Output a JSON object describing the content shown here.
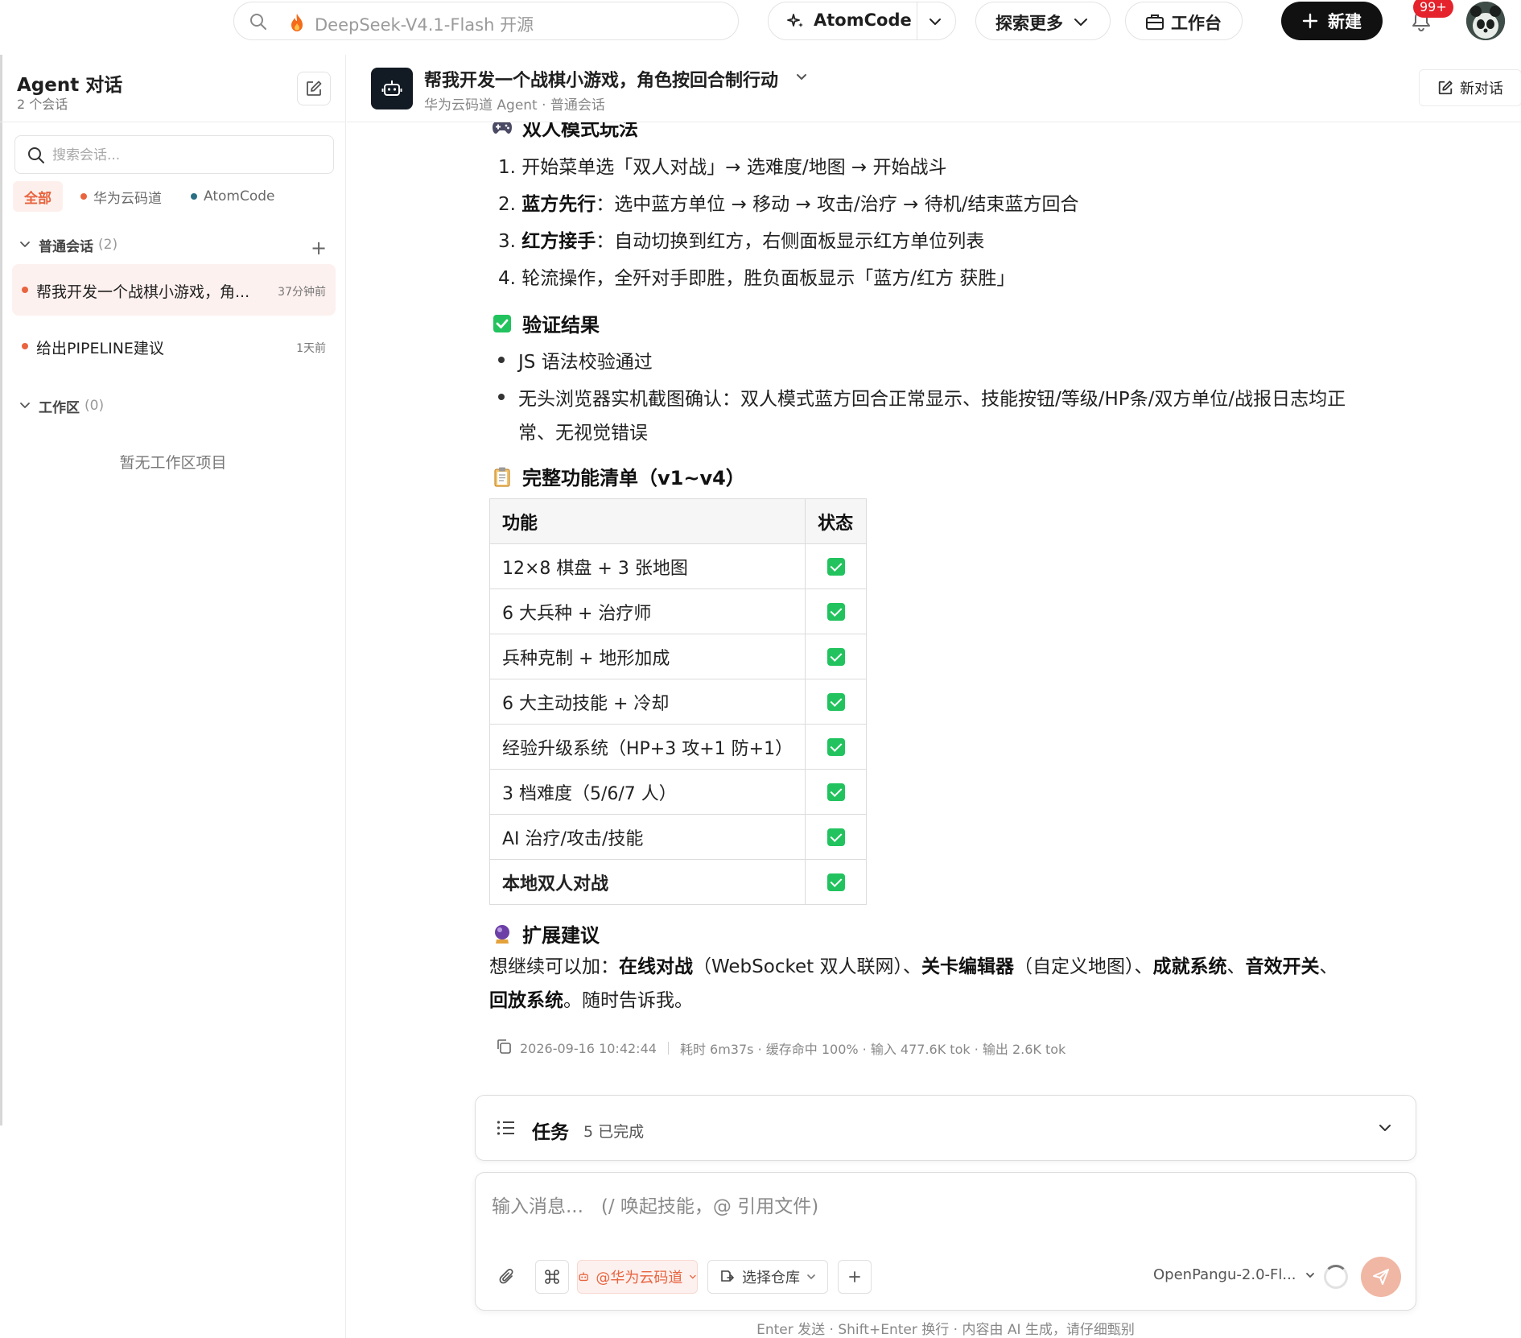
{
  "topbar": {
    "search_placeholder": "DeepSeek-V4.1-Flash 开源",
    "atomcode_label": "AtomCode",
    "explore_label": "探索更多",
    "workbench_label": "工作台",
    "new_label": "新建",
    "notification_badge": "99+"
  },
  "sidebar": {
    "title": "Agent 对话",
    "subtitle": "2 个会话",
    "search_placeholder": "搜索会话...",
    "filters": [
      {
        "label": "全部",
        "color": "#e8643f"
      },
      {
        "label": "华为云码道",
        "color": "#e8643f"
      },
      {
        "label": "AtomCode",
        "color": "#2a6f84"
      }
    ],
    "groups": {
      "normal": {
        "label": "普通会话",
        "count": "(2)"
      },
      "workspace": {
        "label": "工作区",
        "count": "(0)"
      }
    },
    "conversations": [
      {
        "title": "帮我开发一个战棋小游戏，角...",
        "time": "37分钟前"
      },
      {
        "title": "给出PIPELINE建议",
        "time": "1天前"
      }
    ],
    "workspace_empty": "暂无工作区项目"
  },
  "main": {
    "title": "帮我开发一个战棋小游戏，角色按回合制行动",
    "subtitle": "华为云码道 Agent · 普通会话",
    "new_chat_label": "新对话",
    "sections": {
      "mode_title": "双人模式玩法",
      "verify_title": "验证结果",
      "features_title": "完整功能清单（v1~v4）",
      "ext_title": "扩展建议"
    },
    "mode_steps": [
      {
        "num": "1.",
        "bold": "",
        "text": "开始菜单选「双人对战」→ 选难度/地图 → 开始战斗"
      },
      {
        "num": "2.",
        "bold": "蓝方先行",
        "text": "：选中蓝方单位 → 移动 → 攻击/治疗 → 待机/结束蓝方回合"
      },
      {
        "num": "3.",
        "bold": "红方接手",
        "text": "：自动切换到红方，右侧面板显示红方单位列表"
      },
      {
        "num": "4.",
        "bold": "",
        "text": "轮流操作，全歼对手即胜，胜负面板显示「蓝方/红方 获胜」"
      }
    ],
    "verify": {
      "line1": "JS 语法校验通过",
      "line2a": "无头浏览器实机截图确认：双人模式蓝方回合正常显示、技能按钮/等级/HP条/双方单位/战报日志均正",
      "line2b": "常、无视觉错误"
    },
    "table": {
      "headers": [
        "功能",
        "状态"
      ],
      "rows": [
        {
          "feature": "12×8 棋盘 + 3 张地图",
          "done": true
        },
        {
          "feature": "6 大兵种 + 治疗师",
          "done": true
        },
        {
          "feature": "兵种克制 + 地形加成",
          "done": true
        },
        {
          "feature": "6 大主动技能 + 冷却",
          "done": true
        },
        {
          "feature": "经验升级系统（HP+3 攻+1 防+1）",
          "done": true
        },
        {
          "feature": "3 档难度（5/6/7 人）",
          "done": true
        },
        {
          "feature": "AI 治疗/攻击/技能",
          "done": true
        },
        {
          "feature": "本地双人对战",
          "done": true
        }
      ]
    },
    "ext": {
      "p1": "想继续可以加：",
      "b1": "在线对战",
      "p2": "（WebSocket 双人联网）、",
      "b2": "关卡编辑器",
      "p3": "（自定义地图）、",
      "b3": "成就系统",
      "p4": "、",
      "b4": "音效开关",
      "p5": "、",
      "b5": "回放系统",
      "p6": "。随时告诉我。"
    },
    "meta": {
      "timestamp": "2026-09-16 10:42:44",
      "stats": "耗时 6m37s · 缓存命中 100% · 输入 477.6K tok · 输出 2.6K tok"
    }
  },
  "tasks": {
    "label": "任务",
    "count": "5 已完成"
  },
  "composer": {
    "placeholder": "输入消息...   (/ 唤起技能，@ 引用文件)",
    "agent_label": "@华为云码道",
    "repo_label": "选择仓库",
    "model_label": "OpenPangu-2.0-Fl..."
  },
  "footer_note": "Enter 发送 · Shift+Enter 换行 · 内容由 AI 生成，请仔细甄别"
}
